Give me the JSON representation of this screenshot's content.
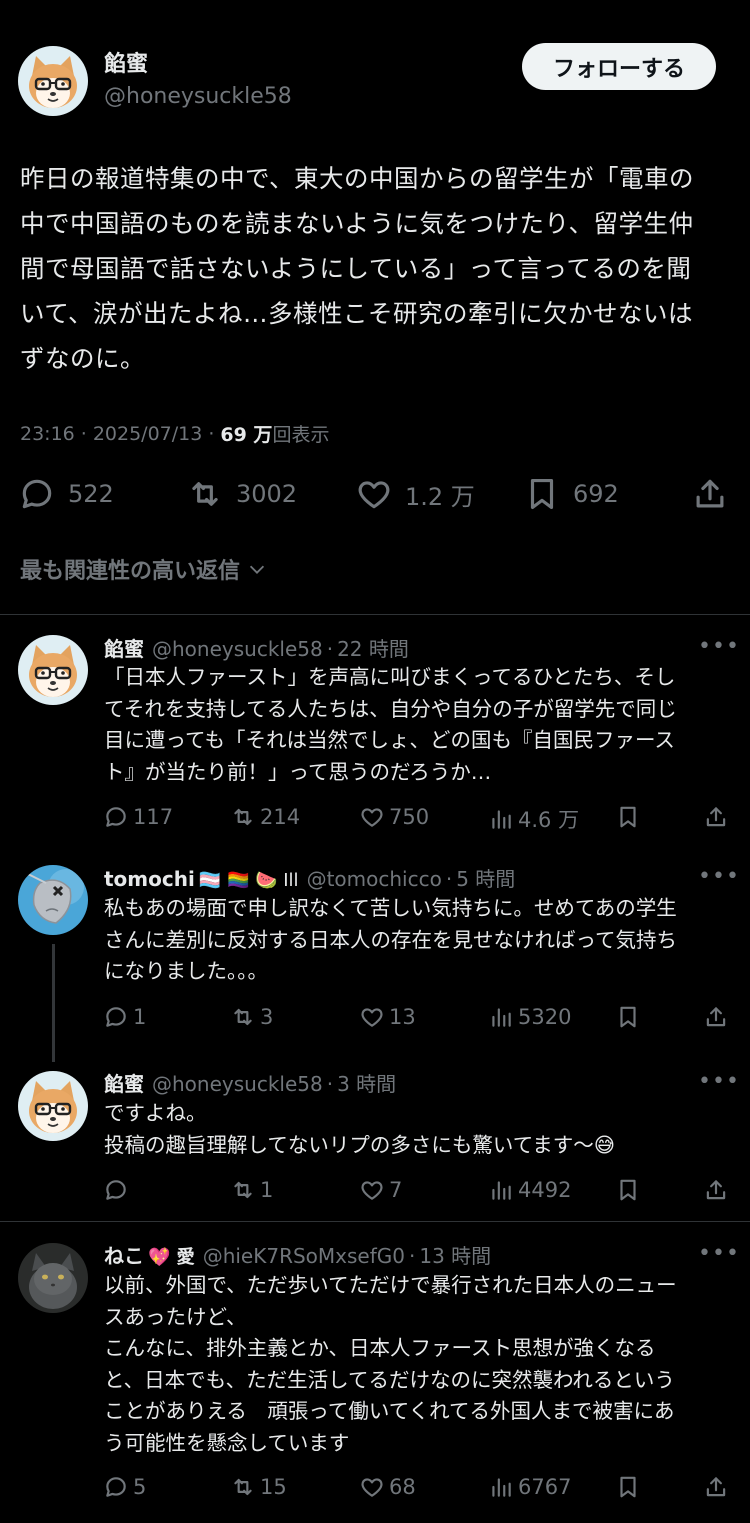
{
  "main": {
    "name": "餡蜜",
    "handle": "@honeysuckle58",
    "follow": "フォローする",
    "text": "昨日の報道特集の中で、東大の中国からの留学生が「電車の\n中で中国語のものを読まないように気をつけたり、留学生仲\n間で母国語で話さないようにしている」って言ってるのを聞\nいて、涙が出たよね…多様性こそ研究の牽引に欠かせないは\nずなのに。",
    "time": "23:16",
    "sep": "·",
    "date": "2025/07/13",
    "views_num": "69 万",
    "views_label": "回表示",
    "replies": "522",
    "reposts": "3002",
    "likes": "1.2 万",
    "bookmarks": "692"
  },
  "relevant_label": "最も関連性の高い返信",
  "replies": [
    {
      "name": "餡蜜",
      "emoji": "",
      "handle": "@honeysuckle58",
      "time": "22 時間",
      "more": "•••",
      "text": "「日本人ファースト」を声高に叫びまくってるひとたち、そし\nてそれを支持してる人たちは、自分や自分の子が留学先で同じ\n目に遭っても「それは当然でしょ、どの国も『自国民ファース\nト』が当たり前！」って思うのだろうか…",
      "reply_count": "117",
      "repost_count": "214",
      "like_count": "750",
      "view_count": "4.6 万"
    },
    {
      "name": "tomochi",
      "emoji": "🏳️‍⚧️ 🏳️‍🌈 🍉 Ill",
      "handle": "@tomochicco",
      "time": "5 時間",
      "more": "•••",
      "text": "私もあの場面で申し訳なくて苦しい気持ちに。せめてあの学生\nさんに差別に反対する日本人の存在を見せなければって気持ち\nになりました。。。",
      "reply_count": "1",
      "repost_count": "3",
      "like_count": "13",
      "view_count": "5320"
    },
    {
      "name": "餡蜜",
      "emoji": "",
      "handle": "@honeysuckle58",
      "time": "3 時間",
      "more": "•••",
      "text": "ですよね。\n投稿の趣旨理解してないリプの多さにも驚いてます〜😅",
      "reply_count": "",
      "repost_count": "1",
      "like_count": "7",
      "view_count": "4492"
    },
    {
      "name": "ねこ",
      "emoji": "💖 愛",
      "handle": "@hieK7RSoMxsefG0",
      "time": "13 時間",
      "more": "•••",
      "text": "以前、外国で、ただ歩いてただけで暴行された日本人のニュー\nスあったけど、\nこんなに、排外主義とか、日本人ファースト思想が強くなる\nと、日本でも、ただ生活してるだけなのに突然襲われるという\nことがありえる　頑張って働いてくれてる外国人まで被害にあ\nう可能性を懸念しています",
      "reply_count": "5",
      "repost_count": "15",
      "like_count": "68",
      "view_count": "6767"
    }
  ],
  "colors": {
    "background": "#000000",
    "text": "#e7e9ea",
    "muted": "#71767b",
    "divider": "#2f3336",
    "button": "#eff3f4"
  }
}
